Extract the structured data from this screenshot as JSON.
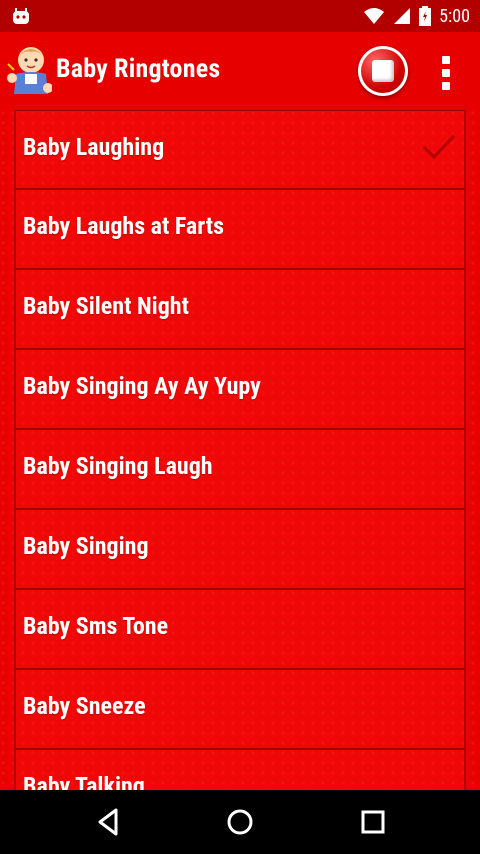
{
  "status": {
    "time": "5:00"
  },
  "app": {
    "title": "Baby Ringtones"
  },
  "items": [
    {
      "label": "Baby Laughing",
      "selected": true
    },
    {
      "label": "Baby Laughs at Farts",
      "selected": false
    },
    {
      "label": "Baby Silent Night",
      "selected": false
    },
    {
      "label": "Baby Singing Ay Ay Yupy",
      "selected": false
    },
    {
      "label": "Baby Singing Laugh",
      "selected": false
    },
    {
      "label": "Baby Singing",
      "selected": false
    },
    {
      "label": "Baby Sms Tone",
      "selected": false
    },
    {
      "label": "Baby Sneeze",
      "selected": false
    },
    {
      "label": "Baby Talking",
      "selected": false
    }
  ],
  "colors": {
    "accent": "#e60000",
    "statusbar": "#b20000",
    "check": "#b30000"
  },
  "icons": {
    "stop": "stop-icon",
    "overflow": "overflow-menu-icon",
    "back": "back-icon",
    "home": "home-icon",
    "recents": "recents-icon"
  }
}
